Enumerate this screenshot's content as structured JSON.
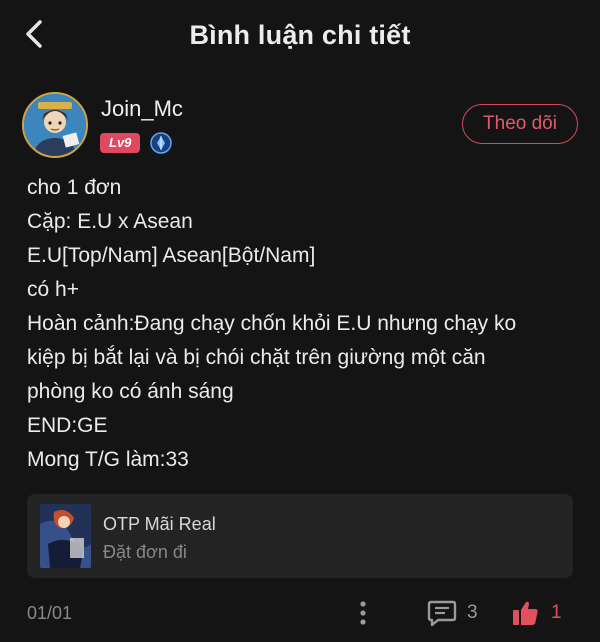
{
  "header": {
    "title": "Bình luận chi tiết",
    "back_icon": "chevron-left-icon"
  },
  "author": {
    "name": "Join_Mc",
    "level": "Lv9",
    "verify_icon": "verified-badge-icon",
    "follow_label": "Theo dõi"
  },
  "content": {
    "lines": [
      "cho 1 đơn",
      "Cặp: E.U x Asean",
      "E.U[Top/Nam] Asean[Bột/Nam]",
      "có h+",
      "Hoàn cảnh:Đang chạy chốn khỏi E.U nhưng chạy ko",
      "kiệp bị bắt lại và bị chói chặt trên giường một căn",
      "phòng ko có ánh sáng",
      "END:GE",
      "Mong T/G làm:33"
    ]
  },
  "reply_card": {
    "title": "OTP Mãi Real",
    "subtitle": "Đặt đơn đi"
  },
  "footer": {
    "page": "01/01",
    "comments": "3",
    "likes": "1",
    "more_icon": "more-vertical-icon",
    "comment_icon": "comment-icon",
    "like_icon": "thumbs-up-icon"
  },
  "colors": {
    "background": "#141414",
    "accent": "#e04860",
    "card": "#232323"
  }
}
